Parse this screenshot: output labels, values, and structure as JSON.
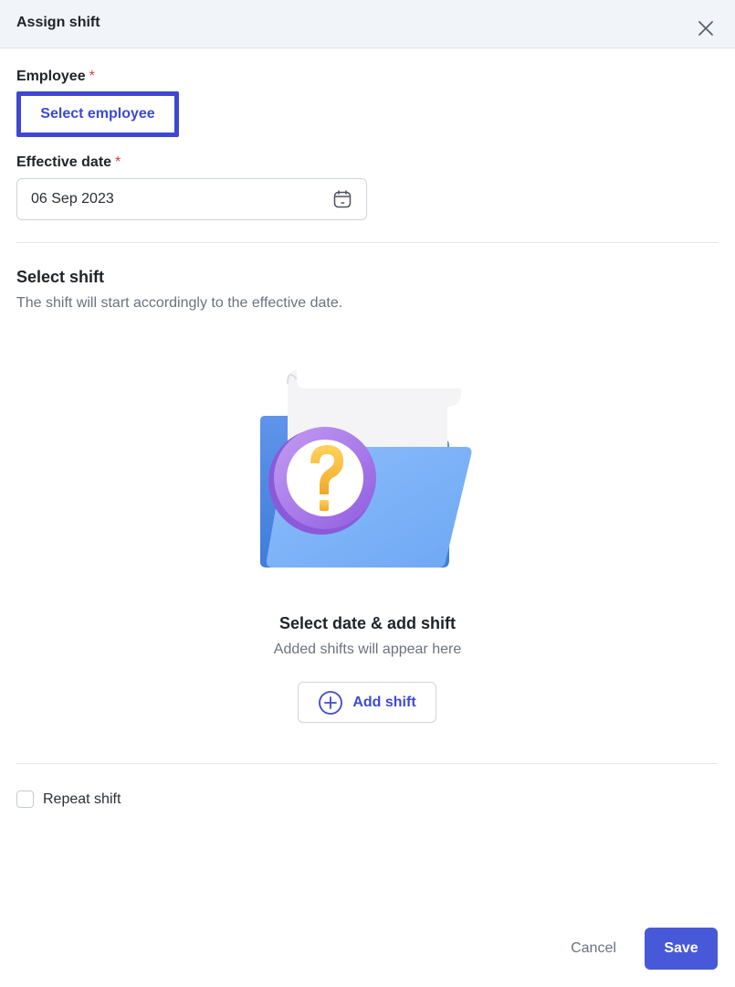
{
  "header": {
    "title": "Assign shift",
    "close_icon": "close-icon"
  },
  "employee": {
    "label": "Employee",
    "required_mark": "*",
    "button_label": "Select employee"
  },
  "effective_date": {
    "label": "Effective date",
    "required_mark": "*",
    "value": "06 Sep 2023",
    "icon": "calendar-icon"
  },
  "select_shift": {
    "title": "Select shift",
    "subtitle": "The shift will start accordingly to the effective date."
  },
  "empty_state": {
    "title": "Select date & add shift",
    "subtitle": "Added shifts will appear here",
    "illustration": "folder-question-illustration"
  },
  "add_shift": {
    "label": "Add shift",
    "icon": "plus-circle-icon"
  },
  "repeat_shift": {
    "label": "Repeat shift",
    "checked": false
  },
  "footer": {
    "cancel_label": "Cancel",
    "save_label": "Save"
  },
  "colors": {
    "accent": "#4759d8",
    "focus_outline": "#3f47d1",
    "required": "#d93b3b",
    "header_bg": "#f1f4f8"
  }
}
